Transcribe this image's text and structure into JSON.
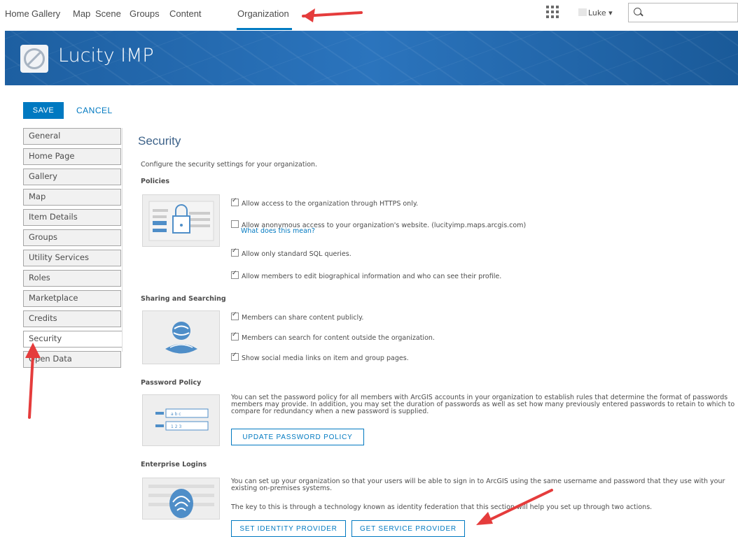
{
  "topnav": {
    "items": [
      "Home",
      "Gallery",
      "Map",
      "Scene",
      "Groups",
      "Content",
      "Organization"
    ],
    "user_name": "Luke",
    "user_caret": "▾"
  },
  "banner": {
    "title": "Lucity IMP"
  },
  "actions": {
    "save_label": "SAVE",
    "cancel_label": "CANCEL"
  },
  "sidebar": {
    "items": [
      {
        "label": "General"
      },
      {
        "label": "Home Page"
      },
      {
        "label": "Gallery"
      },
      {
        "label": "Map"
      },
      {
        "label": "Item Details"
      },
      {
        "label": "Groups"
      },
      {
        "label": "Utility Services"
      },
      {
        "label": "Roles"
      },
      {
        "label": "Marketplace"
      },
      {
        "label": "Credits"
      },
      {
        "label": "Security"
      },
      {
        "label": "Open Data"
      }
    ],
    "active": "Security"
  },
  "security": {
    "title": "Security",
    "intro": "Configure the security settings for your organization.",
    "policies": {
      "title": "Policies",
      "https_label": "Allow access to the organization through HTTPS only.",
      "anon_label": "Allow anonymous access to your organization's website. (lucityimp.maps.arcgis.com)",
      "anon_link": "What does this mean?",
      "sql_label": "Allow only standard SQL queries.",
      "bio_label": "Allow members to edit biographical information and who can see their profile."
    },
    "sharing": {
      "title": "Sharing and Searching",
      "share_label": "Members can share content publicly.",
      "search_label": "Members can search for content outside the organization.",
      "social_label": "Show social media links on item and group pages."
    },
    "password": {
      "title": "Password Policy",
      "text": "You can set the password policy for all members with ArcGIS accounts in your organization to establish rules that determine the format of passwords members may provide. In addition, you may set the duration of passwords as well as set how many previously entered passwords to retain to which to compare for redundancy when a new password is supplied.",
      "button": "UPDATE PASSWORD POLICY"
    },
    "enterprise": {
      "title": "Enterprise Logins",
      "text1": "You can set up your organization so that your users will be able to sign in to ArcGIS using the same username and password that they use with your existing on-premises systems.",
      "text2": "The key to this is through a technology known as identity federation that this section will help you set up through two actions.",
      "identity_button": "SET IDENTITY PROVIDER",
      "service_button": "GET SERVICE PROVIDER"
    }
  }
}
